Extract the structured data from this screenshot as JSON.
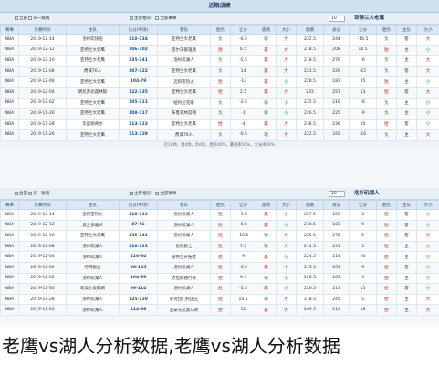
{
  "page_title": "近期战绩",
  "caption": "老鹰vs湖人分析数据,老鹰vs湖人分析数据",
  "columns": [
    "赛事",
    "比赛时间",
    "主队",
    "比分(半场)",
    "客队",
    "胜负",
    "让分",
    "盘路",
    "大小",
    "盘路",
    "总分",
    "让分",
    "胜负",
    "主队",
    "大小"
  ],
  "filters": {
    "home_away": "主客相同",
    "all_events": "全部赛事",
    "all": "全部",
    "same_event": "同一联赛",
    "count": "10"
  },
  "section1": {
    "team_name": "亚特兰大老鹰",
    "summary": "近10场，胜4场，负6场，胜率40%，赢盘率50%，大分率80%",
    "rows": [
      [
        "NBA",
        "2019-12-14",
        "洛杉矶快船",
        "110-134",
        "亚特兰大老鹰",
        "负",
        "-6.5",
        "输",
        "大",
        "222.5",
        "244",
        "-16.5",
        "负",
        "客",
        "大"
      ],
      [
        "NBA",
        "2019-12-12",
        "亚特兰大老鹰",
        "106-102",
        "密尔沃基雄鹿",
        "胜",
        "6.5",
        "赢",
        "大",
        "218.5",
        "208",
        "10.5",
        "胜",
        "主",
        "小"
      ],
      [
        "NBA",
        "2019-12-10",
        "亚特兰大老鹰",
        "135-141",
        "洛杉矶湖人",
        "负",
        "-5.5",
        "赢",
        "大",
        "218.5",
        "276",
        "-6",
        "负",
        "主",
        "大"
      ],
      [
        "NBA",
        "2019-12-08",
        "费城76人",
        "107-122",
        "亚特兰大老鹰",
        "负",
        "14",
        "赢",
        "大",
        "223.5",
        "229",
        "-15",
        "负",
        "客",
        "大"
      ],
      [
        "NBA",
        "2019-12-06",
        "亚特兰大老鹰",
        "104-79",
        "迈阿密热火",
        "胜",
        "-13",
        "赢",
        "小",
        "228.5",
        "183",
        "25",
        "胜",
        "主",
        "小"
      ],
      [
        "NBA",
        "2019-12-04",
        "明尼苏达森林狼",
        "122-135",
        "亚特兰大老鹰",
        "胜",
        "2.5",
        "赢",
        "大",
        "233",
        "257",
        "13",
        "胜",
        "客",
        "大"
      ],
      [
        "NBA",
        "2019-12-02",
        "亚特兰大老鹰",
        "105-111",
        "纽约尼克斯",
        "负",
        "-2.5",
        "输",
        "小",
        "225.5",
        "216",
        "-6",
        "负",
        "主",
        "小"
      ],
      [
        "NBA",
        "2019-11-30",
        "亚特兰大老鹰",
        "108-117",
        "布鲁克林篮网",
        "负",
        "-1",
        "输",
        "小",
        "226.5",
        "225",
        "-9",
        "负",
        "主",
        "小"
      ],
      [
        "NBA",
        "2019-11-28",
        "华盛顿奇才",
        "113-123",
        "亚特兰大老鹰",
        "胜",
        "-4",
        "赢",
        "大",
        "238.5",
        "236",
        "10",
        "胜",
        "客",
        "小"
      ],
      [
        "NBA",
        "2019-11-26",
        "亚特兰大老鹰",
        "113-129",
        "费城76人",
        "负",
        "-6.5",
        "输",
        "大",
        "222.5",
        "242",
        "-16",
        "负",
        "主",
        "大"
      ]
    ]
  },
  "section2": {
    "team_name": "洛杉矶湖人",
    "summary": "近10场，胜9场，负1场，胜率90%，赢盘率60%，大分率40%",
    "rows": [
      [
        "NBA",
        "2019-12-14",
        "迈阿密热火",
        "110-113",
        "洛杉矶湖人",
        "胜",
        "-3.5",
        "赢",
        "小",
        "227.5",
        "223",
        "3",
        "胜",
        "客",
        "小"
      ],
      [
        "NBA",
        "2019-12-12",
        "奥兰多魔术",
        "87-96",
        "洛杉矶湖人",
        "胜",
        "-6.5",
        "赢",
        "小",
        "218.5",
        "183",
        "9",
        "胜",
        "客",
        "小"
      ],
      [
        "NBA",
        "2019-12-10",
        "亚特兰大老鹰",
        "135-141",
        "洛杉矶湖人",
        "胜",
        "-10.5",
        "输",
        "大",
        "225.5",
        "276",
        "6",
        "胜",
        "客",
        "大"
      ],
      [
        "NBA",
        "2019-12-08",
        "洛杉矶湖人",
        "128-123",
        "犹他爵士",
        "胜",
        "7.5",
        "输",
        "大",
        "214.5",
        "251",
        "5",
        "胜",
        "主",
        "大"
      ],
      [
        "NBA",
        "2019-12-06",
        "洛杉矶湖人",
        "120-94",
        "波特兰开拓者",
        "胜",
        "9",
        "赢",
        "小",
        "224.5",
        "214",
        "26",
        "胜",
        "主",
        "小"
      ],
      [
        "NBA",
        "2019-12-04",
        "丹佛掘金",
        "96-105",
        "洛杉矶湖人",
        "胜",
        "-3.5",
        "赢",
        "小",
        "213.5",
        "201",
        "9",
        "胜",
        "客",
        "小"
      ],
      [
        "NBA",
        "2019-12-02",
        "洛杉矶湖人",
        "104-99",
        "达拉斯独行侠",
        "胜",
        "9.5",
        "输",
        "小",
        "228.5",
        "203",
        "5",
        "胜",
        "主",
        "小"
      ],
      [
        "NBA",
        "2019-11-30",
        "新奥尔良鹈鹕",
        "99-114",
        "洛杉矶湖人",
        "胜",
        "-5.5",
        "赢",
        "小",
        "226.5",
        "213",
        "15",
        "胜",
        "客",
        "小"
      ],
      [
        "NBA",
        "2019-11-28",
        "洛杉矶湖人",
        "125-120",
        "萨克拉门托国王",
        "胜",
        "10.5",
        "输",
        "大",
        "218.5",
        "245",
        "5",
        "胜",
        "主",
        "大"
      ],
      [
        "NBA",
        "2019-11-26",
        "洛杉矶湖人",
        "114-96",
        "圣安东尼奥马刺",
        "胜",
        "11",
        "赢",
        "大",
        "209.5",
        "210",
        "18",
        "胜",
        "主",
        "大"
      ]
    ]
  }
}
